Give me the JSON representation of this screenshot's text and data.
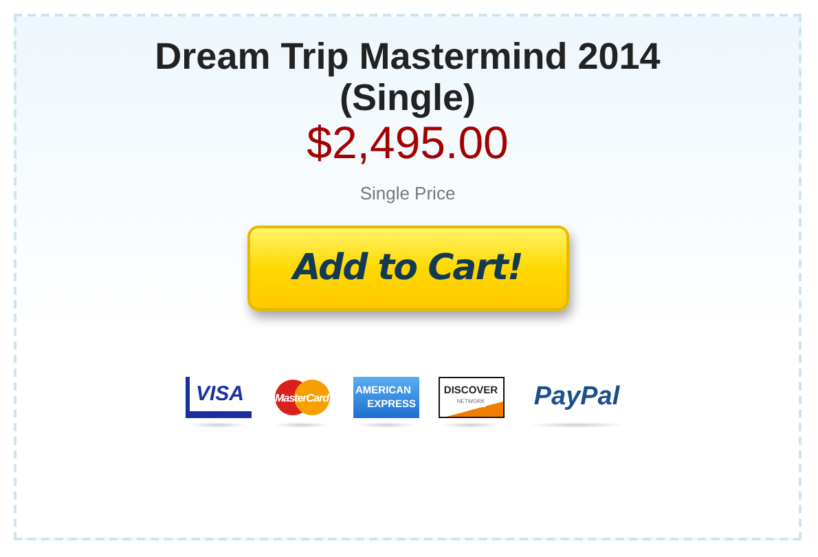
{
  "product": {
    "title": "Dream Trip Mastermind 2014 (Single)",
    "price": "$2,495.00",
    "price_label": "Single Price"
  },
  "button": {
    "label": "Add to Cart!"
  },
  "payment_logos": [
    {
      "kind": "visa",
      "lines": [
        "VISA"
      ]
    },
    {
      "kind": "mastercard",
      "lines": [
        "MasterCard"
      ]
    },
    {
      "kind": "amex",
      "lines": [
        "AMERICAN",
        "EXPRESS"
      ]
    },
    {
      "kind": "discover",
      "lines": [
        "DISCOVER",
        "NETWORK"
      ]
    },
    {
      "kind": "paypal",
      "lines": [
        "PayPal"
      ]
    }
  ]
}
